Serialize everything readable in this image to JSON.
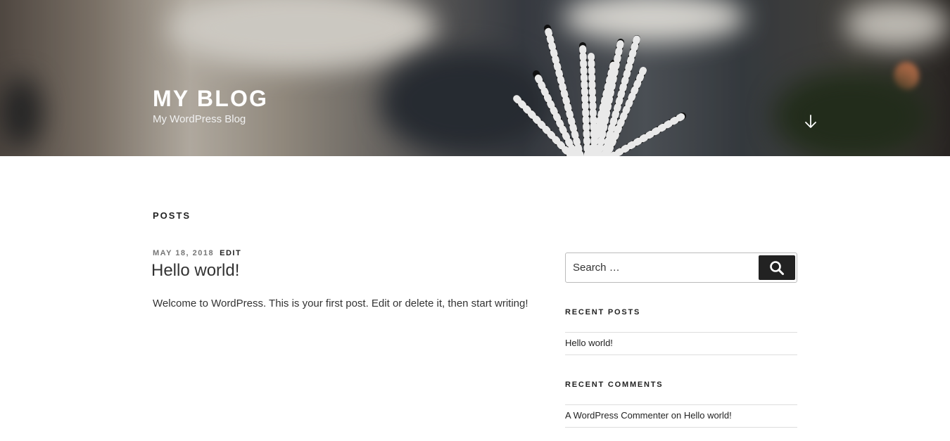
{
  "header": {
    "site_title": "MY BLOG",
    "site_description": "My WordPress Blog",
    "scroll_icon": "arrow-down-icon"
  },
  "main": {
    "page_title": "POSTS",
    "post": {
      "date": "MAY 18, 2018",
      "edit_label": "EDIT",
      "title": "Hello world!",
      "excerpt": "Welcome to WordPress. This is your first post. Edit or delete it, then start writing!"
    }
  },
  "sidebar": {
    "search": {
      "placeholder": "Search …",
      "button_icon": "search-icon"
    },
    "recent_posts": {
      "title": "RECENT POSTS",
      "items": [
        "Hello world!"
      ]
    },
    "recent_comments": {
      "title": "RECENT COMMENTS",
      "items": [
        {
          "author": "A WordPress Commenter",
          "on": " on ",
          "post": "Hello world!"
        }
      ]
    }
  },
  "colors": {
    "text": "#333333",
    "heading": "#222222",
    "meta": "#767676",
    "button_bg": "#222222",
    "border": "#dddddd"
  }
}
